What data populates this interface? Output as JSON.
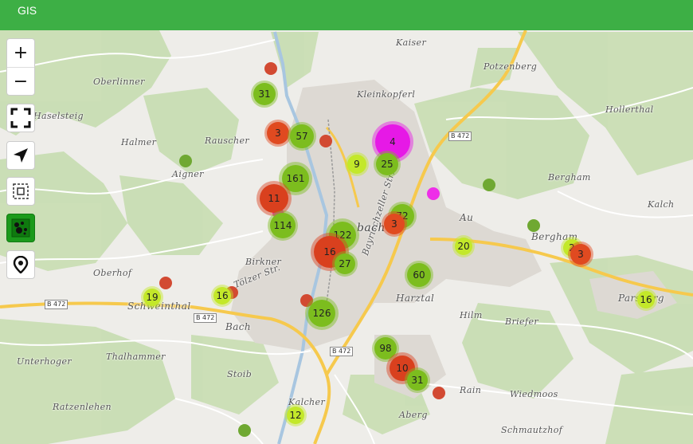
{
  "app": {
    "title": "GIS"
  },
  "controls": {
    "zoom_in_label": "+",
    "zoom_out_label": "−",
    "icons": [
      "fullscreen-icon",
      "locate-arrow-icon",
      "box-select-icon",
      "cluster-layer-icon",
      "marker-pin-icon"
    ]
  },
  "colors": {
    "header": "#3daf45",
    "cluster_green": "#7cbd1e",
    "cluster_lime": "#c3e82a",
    "cluster_red": "#d9401e",
    "cluster_magenta": "#e619e6",
    "dot_red": "#d24a32",
    "dot_green": "#6fa832",
    "dot_magenta": "#ee2ee8"
  },
  "places": [
    "Kaiser",
    "Potzenberg",
    "Oberlinner",
    "Haselsteig",
    "Kleinkopferl",
    "Hollerthal",
    "Halmer",
    "Rauscher",
    "Aigner",
    "Bergham",
    "Kalch",
    "Au",
    "Bergham",
    "Birkner",
    "Oberhof",
    "Tölzer Str.",
    "Bayrischzeller Str.",
    "Parsberg",
    "Schweinthal",
    "Bach",
    "Harztal",
    "Hilm",
    "Briefer",
    "Thalhammer",
    "Unterhoger",
    "Stoib",
    "Rain",
    "Wiedmoos",
    "Kalcher",
    "Ratzenlehen",
    "Aberg",
    "Schmautzhof",
    "bach"
  ],
  "road_labels": [
    "B 472",
    "B 472",
    "B 472",
    "B 472"
  ],
  "clusters": [
    {
      "label": "31"
    },
    {
      "label": "3"
    },
    {
      "label": "57"
    },
    {
      "label": "4"
    },
    {
      "label": "9"
    },
    {
      "label": "25"
    },
    {
      "label": "161"
    },
    {
      "label": "11"
    },
    {
      "label": "114"
    },
    {
      "label": "122"
    },
    {
      "label": "72"
    },
    {
      "label": "3"
    },
    {
      "label": "16"
    },
    {
      "label": "27"
    },
    {
      "label": "20"
    },
    {
      "label": "60"
    },
    {
      "label": "2"
    },
    {
      "label": "3"
    },
    {
      "label": "19"
    },
    {
      "label": "16"
    },
    {
      "label": "126"
    },
    {
      "label": "16"
    },
    {
      "label": "98"
    },
    {
      "label": "10"
    },
    {
      "label": "31"
    },
    {
      "label": "12"
    }
  ]
}
